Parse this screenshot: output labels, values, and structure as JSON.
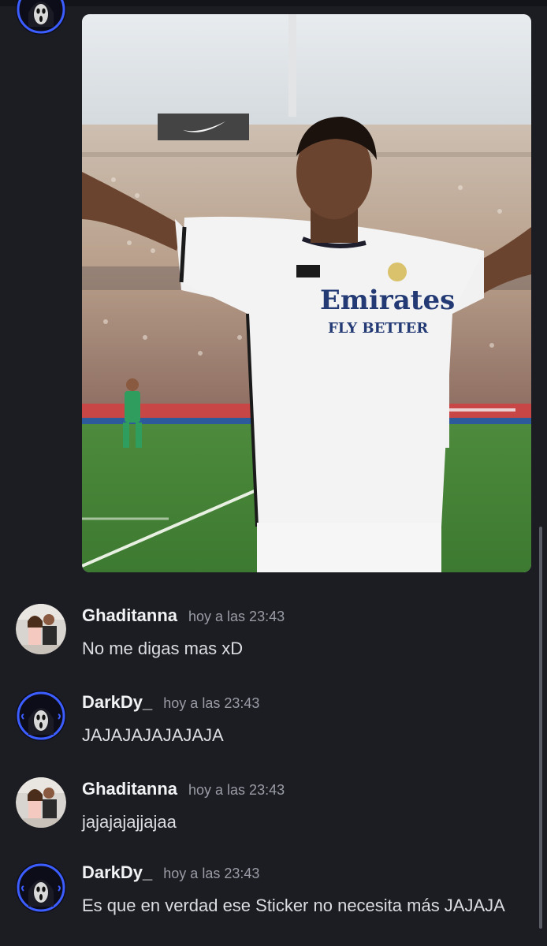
{
  "media": {
    "sponsor_line1": "Emirates",
    "sponsor_line2": "FLY BETTER"
  },
  "messages": [
    {
      "username": "Ghaditanna",
      "timestamp": "hoy a las 23:43",
      "text": "No me digas mas xD"
    },
    {
      "username": "DarkDy_",
      "timestamp": "hoy a las 23:43",
      "text": "JAJAJAJAJAJAJA"
    },
    {
      "username": "Ghaditanna",
      "timestamp": "hoy a las 23:43",
      "text": "jajajajajjajaa"
    },
    {
      "username": "DarkDy_",
      "timestamp": "hoy a las 23:43",
      "text": "Es que en verdad ese Sticker no necesita más JAJAJA"
    }
  ],
  "icons": {
    "avatar_ghaditanna": "avatar-couple-icon",
    "avatar_darkdy": "avatar-ghostface-icon"
  },
  "colors": {
    "background": "#1c1d22",
    "username": "#f2f3f5",
    "timestamp": "#9a9ca6",
    "message_text": "#dcdde2",
    "avatar_ring_blue": "#3c5dff"
  }
}
